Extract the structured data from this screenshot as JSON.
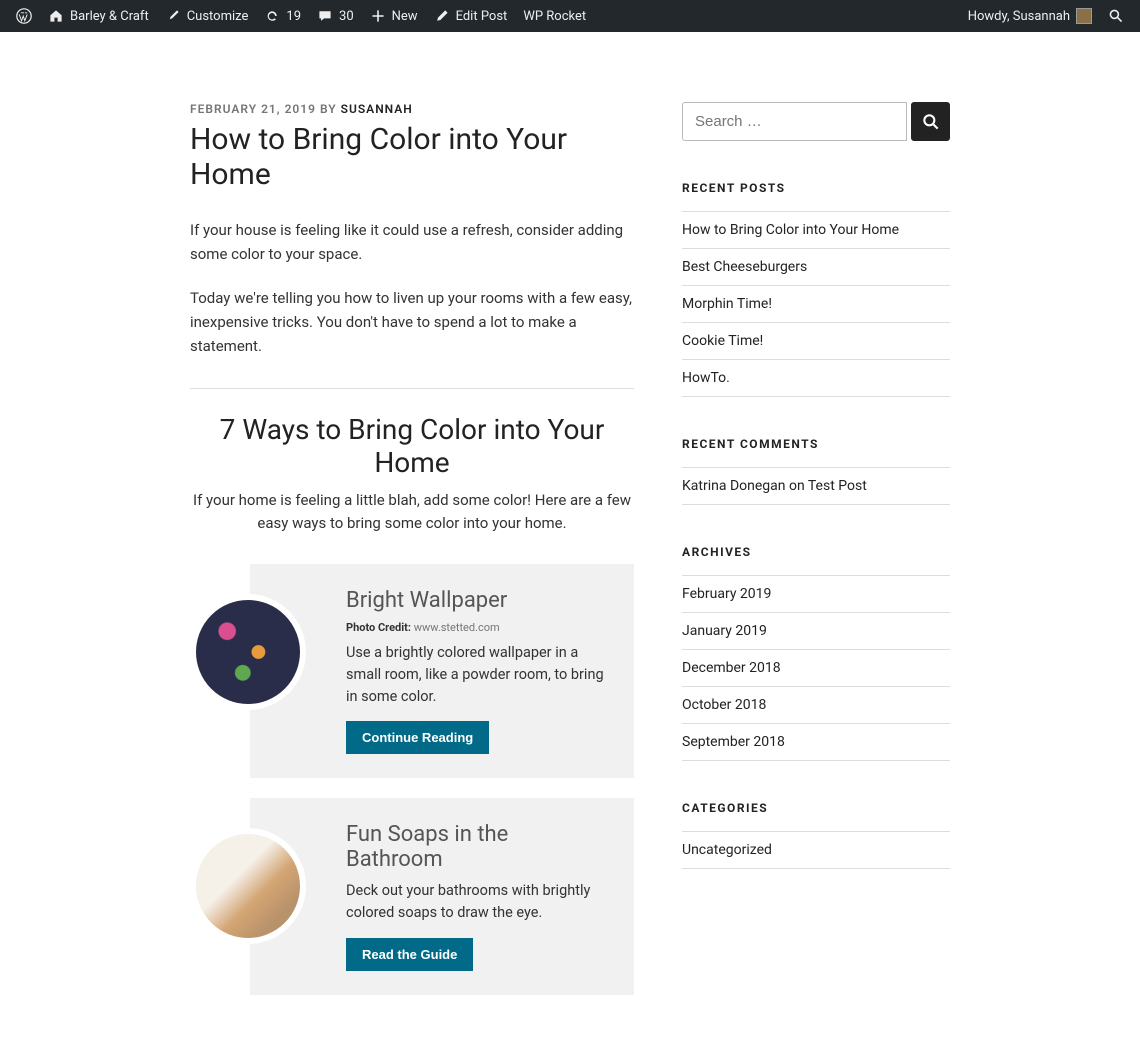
{
  "adminbar": {
    "site_name": "Barley & Craft",
    "customize": "Customize",
    "updates": "19",
    "comments": "30",
    "new": "New",
    "edit_post": "Edit Post",
    "wp_rocket": "WP Rocket",
    "howdy": "Howdy, Susannah"
  },
  "post": {
    "date": "FEBRUARY 21, 2019",
    "by": " BY ",
    "author": "SUSANNAH",
    "title": "How to Bring Color into Your Home",
    "para1": "If your house is feeling like it could use a refresh, consider adding some color to your space.",
    "para2": "Today we're telling you how to liven up your rooms with a few easy, inexpensive tricks. You don't have to spend a lot to make a statement."
  },
  "list": {
    "heading": "7 Ways to Bring Color into Your Home",
    "sub": "If your home is feeling a little blah, add some color! Here are a few easy ways to bring some color into your home."
  },
  "cards": [
    {
      "title": "Bright Wallpaper",
      "credit_label": "Photo Credit:",
      "credit_value": " www.stetted.com",
      "desc": "Use a brightly colored wallpaper in a small room, like a powder room, to bring in some color.",
      "btn": "Continue Reading"
    },
    {
      "title": "Fun Soaps in the Bathroom",
      "desc": "Deck out your bathrooms with brightly colored soaps to draw the eye.",
      "btn": "Read the Guide"
    }
  ],
  "search": {
    "placeholder": "Search …"
  },
  "widgets": {
    "recent_posts": {
      "title": "RECENT POSTS",
      "items": [
        "How to Bring Color into Your Home",
        "Best Cheeseburgers",
        "Morphin Time!",
        "Cookie Time!",
        "HowTo."
      ]
    },
    "recent_comments": {
      "title": "RECENT COMMENTS",
      "items": [
        "Katrina Donegan on Test Post"
      ]
    },
    "archives": {
      "title": "ARCHIVES",
      "items": [
        "February 2019",
        "January 2019",
        "December 2018",
        "October 2018",
        "September 2018"
      ]
    },
    "categories": {
      "title": "CATEGORIES",
      "items": [
        "Uncategorized"
      ]
    }
  }
}
